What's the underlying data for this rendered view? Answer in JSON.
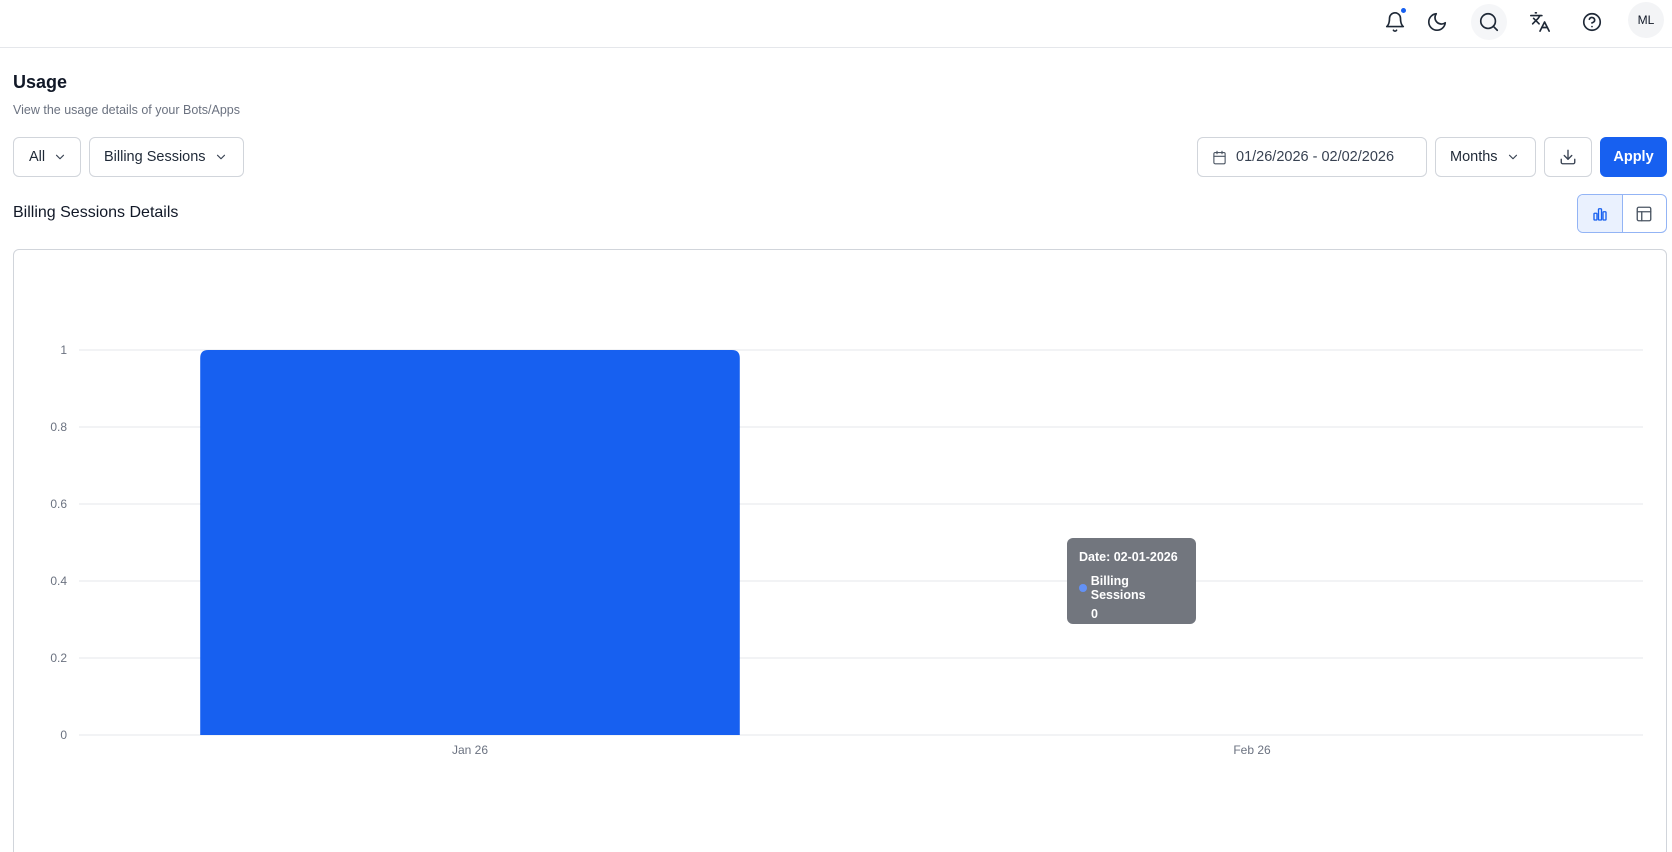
{
  "header": {
    "icons": [
      "bell-icon",
      "moon-icon",
      "search-icon",
      "translate-icon",
      "help-icon"
    ],
    "avatar_initials": "ML",
    "accent_color": "#1760f0"
  },
  "page": {
    "title": "Usage",
    "subtitle": "View the usage details of your Bots/Apps"
  },
  "filters": {
    "scope_label": "All",
    "metric_label": "Billing Sessions",
    "date_range": "01/26/2026 - 02/02/2026",
    "granularity_label": "Months",
    "apply_label": "Apply"
  },
  "section": {
    "title": "Billing Sessions Details",
    "view_toggle": [
      "bar-chart-icon",
      "table-icon"
    ],
    "active_view": "bar-chart-icon"
  },
  "chart_data": {
    "type": "bar",
    "categories": [
      "Jan 26",
      "Feb 26"
    ],
    "series": [
      {
        "name": "Billing Sessions",
        "values": [
          1,
          0
        ],
        "color": "#1760f0"
      }
    ],
    "yticks": [
      "0",
      "0.2",
      "0.4",
      "0.6",
      "0.8",
      "1"
    ],
    "ylim": [
      0,
      1
    ],
    "grid": true,
    "title": "",
    "xlabel": "",
    "ylabel": ""
  },
  "tooltip": {
    "date_text": "Date: 02-01-2026",
    "series_name": "Billing Sessions",
    "value_text": "0"
  }
}
